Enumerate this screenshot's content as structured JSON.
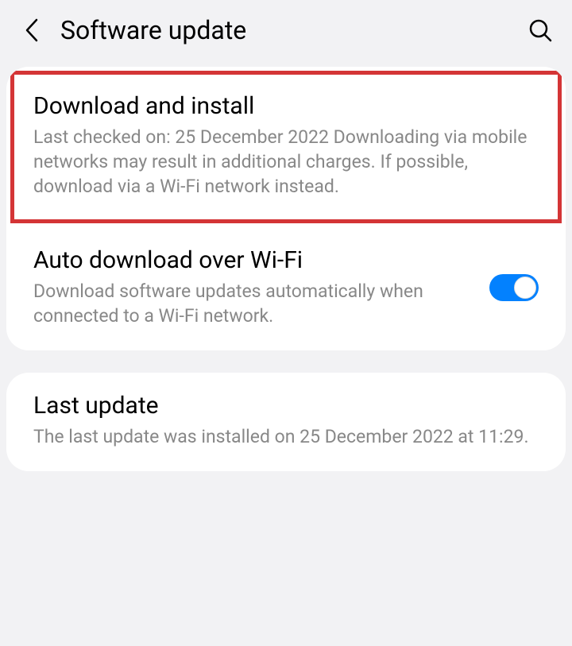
{
  "header": {
    "title": "Software update"
  },
  "download": {
    "title": "Download and install",
    "desc": "Last checked on: 25 December 2022\nDownloading via mobile networks may result in additional charges. If possible, download via a Wi-Fi network instead."
  },
  "autoDownload": {
    "title": "Auto download over Wi-Fi",
    "desc": "Download software updates automatically when connected to a Wi-Fi network.",
    "enabled": true
  },
  "lastUpdate": {
    "title": "Last update",
    "desc": "The last update was installed on 25 December 2022 at 11:29."
  }
}
